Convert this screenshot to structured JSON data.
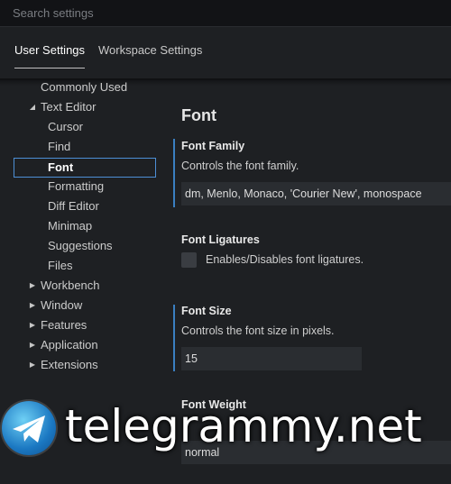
{
  "search": {
    "placeholder": "Search settings"
  },
  "tabs": [
    {
      "label": "User Settings",
      "active": true
    },
    {
      "label": "Workspace Settings",
      "active": false
    }
  ],
  "tree": {
    "commonly_used": "Commonly Used",
    "text_editor": "Text Editor",
    "text_editor_children": [
      "Cursor",
      "Find",
      "Font",
      "Formatting",
      "Diff Editor",
      "Minimap",
      "Suggestions",
      "Files"
    ],
    "selected": "Font",
    "collapsed": [
      "Workbench",
      "Window",
      "Features",
      "Application",
      "Extensions"
    ]
  },
  "content": {
    "section_title": "Font",
    "font_family": {
      "name": "Font Family",
      "description": "Controls the font family.",
      "value": "dm, Menlo, Monaco, 'Courier New', monospace"
    },
    "font_ligatures": {
      "name": "Font Ligatures",
      "description": "Enables/Disables font ligatures.",
      "checked": false
    },
    "font_size": {
      "name": "Font Size",
      "description": "Controls the font size in pixels.",
      "value": "15"
    },
    "font_weight": {
      "name": "Font Weight",
      "value": "normal"
    }
  },
  "watermark": {
    "text": "telegrammy.net"
  },
  "colors": {
    "accent": "#3a7fc1",
    "selection_border": "#4d8fd6",
    "background": "#1e2023"
  }
}
